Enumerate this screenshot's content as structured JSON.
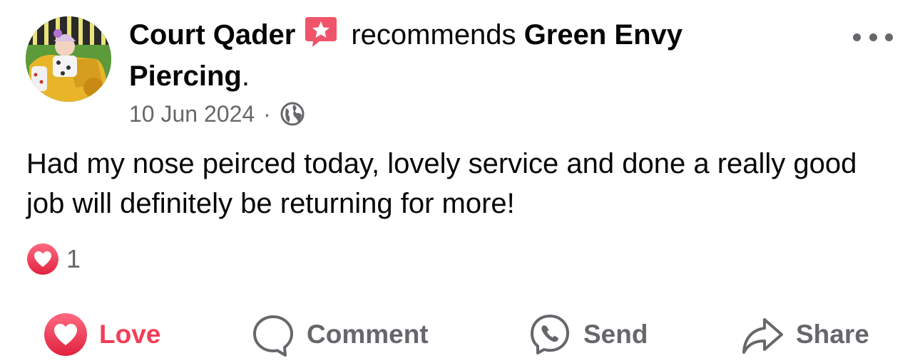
{
  "post": {
    "author_name": "Court Qader",
    "recommends_text": "recommends",
    "page_name": "Green Envy Piercing",
    "period": ".",
    "date": "10 Jun 2024",
    "separator": "·",
    "audience_icon": "globe-icon",
    "body": "Had my nose peirced today, lovely service and done a really good job will definitely be returning for more!",
    "reaction_type": "love",
    "reaction_count": "1",
    "more_icon": "more-options-icon"
  },
  "actions": {
    "love_label": "Love",
    "comment_label": "Comment",
    "send_label": "Send",
    "share_label": "Share"
  },
  "colors": {
    "love_red": "#f33e58",
    "badge_pink": "#f0546a",
    "secondary_text": "#65676b",
    "primary_text": "#050505"
  }
}
